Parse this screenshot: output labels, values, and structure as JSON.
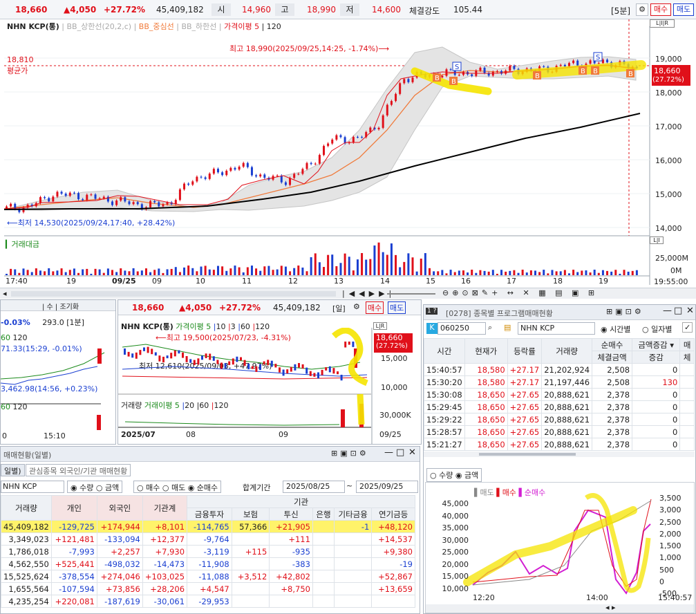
{
  "quote": {
    "price": "18,660",
    "change": "▲4,050",
    "change_pct": "+27.72%",
    "volume": "45,409,182",
    "open_label": "시",
    "open": "14,960",
    "high_label": "고",
    "high": "18,990",
    "low_label": "저",
    "low": "14,600",
    "strength_label": "체결강도",
    "strength": "105.44",
    "interval": "[5분]",
    "buy_label": "매수",
    "sell_label": "매도"
  },
  "main_chart": {
    "legend_name": "NHN KCP(통)",
    "legend_items": [
      "BB_상한선(20,2,c)",
      "BB_중심선",
      "BB_하한선",
      "가격이평 5",
      "120"
    ],
    "legend_colors": [
      "#bbbbbb",
      "#f07a3a",
      "#bbbbbb",
      "#e0101a",
      "#000000"
    ],
    "avg_label": "평균가",
    "avg_value": "18,810",
    "high_annot": "최고 18,990(2025/09/25,14:25, -1.74%)⟶",
    "low_annot": "⟵최저 14,530(2025/09/24,17:40, +28.42%)",
    "price_tag": "18,660",
    "price_tag_pct": "(27.72%)",
    "y_ticks": [
      "19,000",
      "18,000",
      "17,000",
      "16,000",
      "15,000",
      "14,000"
    ],
    "volume_label": "거래대금",
    "volume_ticks": [
      "25,000M",
      "0M"
    ],
    "x_ticks": [
      "17:40",
      "19",
      "09/25",
      "09",
      "10",
      "11",
      "12",
      "13",
      "14",
      "15",
      "16",
      "17",
      "18",
      "19",
      "19:55:00"
    ],
    "chart_data": {
      "type": "candlestick",
      "ylim": [
        14000,
        19200
      ],
      "close_approx": [
        14560,
        14620,
        14980,
        14950,
        14850,
        14760,
        14640,
        14720,
        15450,
        15600,
        15820,
        15480,
        15380,
        15850,
        16650,
        16580,
        17100,
        18400,
        18500,
        18560,
        18560,
        18600,
        18650,
        18650,
        18800,
        18850,
        18870,
        18660
      ],
      "ma120": [
        14560,
        14580,
        14600,
        14640,
        14700,
        14800,
        14950,
        15200,
        15500,
        15800,
        16100,
        16400,
        16750,
        17000,
        17200,
        17350
      ]
    }
  },
  "left_mini": {
    "pct": "-0.03%",
    "val": "293.0",
    "interval": "[1분]",
    "line1": "71.33(15:29, -0.01%)",
    "line2": "3,462.98(14:56, +0.23%)",
    "ma_items": [
      "60",
      "120"
    ],
    "x_ticks": [
      "0",
      "15:10"
    ]
  },
  "day_chart": {
    "price": "18,660",
    "change": "▲4,050",
    "change_pct": "+27.72%",
    "volume": "45,409,182",
    "interval": "[일]",
    "buy_label": "매수",
    "sell_label": "매도",
    "legend_name": "NHN KCP(통)",
    "legend_items": [
      "가격이평 5",
      "10",
      "3",
      "60",
      "120"
    ],
    "high_annot": "⟵최고 19,500(2025/07/23, -4.31%)",
    "low_annot": "최저 12,610(2025/09/03, +47.97%)",
    "price_tag": "18,660",
    "price_tag_pct": "(27.72%)",
    "y_ticks": [
      "15,000",
      "10,000"
    ],
    "vol_legend": [
      "거래량",
      "거래이평 5",
      "20",
      "60",
      "120"
    ],
    "vol_tick": "30,000K",
    "x_ticks": [
      "2025/07",
      "08",
      "09",
      "09/25"
    ]
  },
  "program": {
    "window_title": "[0278] 종목별 프로그램매매현황",
    "code": "060250",
    "name": "NHN KCP",
    "radio_time": "시간별",
    "radio_day": "일자별",
    "headers": [
      "시간",
      "현재가",
      "등락률",
      "거래량",
      "순매수",
      "금액증감",
      "매"
    ],
    "subheaders": [
      "체결금액",
      "증감",
      "체"
    ],
    "rows": [
      [
        "15:40:57",
        "18,580",
        "+27.17",
        "21,202,924",
        "2,508",
        "0"
      ],
      [
        "15:30:20",
        "18,580",
        "+27.17",
        "21,197,446",
        "2,508",
        "130"
      ],
      [
        "15:30:08",
        "18,650",
        "+27.65",
        "20,888,621",
        "2,378",
        "0"
      ],
      [
        "15:29:45",
        "18,650",
        "+27.65",
        "20,888,621",
        "2,378",
        "0"
      ],
      [
        "15:29:22",
        "18,650",
        "+27.65",
        "20,888,621",
        "2,378",
        "0"
      ],
      [
        "15:28:57",
        "18,650",
        "+27.65",
        "20,888,621",
        "2,378",
        "0"
      ],
      [
        "15:21:27",
        "18,650",
        "+27.65",
        "20,888,621",
        "2,378",
        "0"
      ]
    ],
    "radio_qty": "수량",
    "radio_amount": "금액",
    "legend": [
      "매도",
      "매수",
      "순매수"
    ],
    "y_left": [
      "45,000",
      "40,000",
      "35,000",
      "30,000",
      "25,000",
      "20,000",
      "15,000",
      "10,000"
    ],
    "y_right": [
      "3,500",
      "3,000",
      "2,500",
      "2,000",
      "1,500",
      "1,000",
      "500",
      "0",
      "-500"
    ],
    "x_ticks": [
      "12:20",
      "14:00",
      "15:40:57"
    ]
  },
  "investor": {
    "window_title": "매매현황(일별)",
    "tabs": [
      "일별)",
      "관심종목 외국인/기관 매매현황"
    ],
    "name": "NHN KCP",
    "radios": [
      "수량",
      "금액",
      "매수",
      "매도",
      "순매수"
    ],
    "period_label": "합계기간",
    "date_from": "2025/08/25",
    "date_to": "2025/09/25",
    "group_header": "기관",
    "headers": [
      "거래량",
      "개인",
      "외국인",
      "기관계",
      "금융투자",
      "보험",
      "투신",
      "은행",
      "기타금융",
      "연기금등"
    ],
    "rows": [
      [
        "45,409,182",
        "-129,725",
        "+174,944",
        "+8,101",
        "-114,765",
        "57,366",
        "+21,905",
        "",
        "-1",
        "+48,120"
      ],
      [
        "3,349,023",
        "+121,481",
        "-133,094",
        "+12,377",
        "-9,764",
        "",
        "+111",
        "",
        "",
        "+14,537"
      ],
      [
        "1,786,018",
        "-7,993",
        "+2,257",
        "+7,930",
        "-3,119",
        "+115",
        "-935",
        "",
        "",
        "+9,380"
      ],
      [
        "4,562,550",
        "+525,441",
        "-498,032",
        "-14,473",
        "-11,908",
        "",
        "-383",
        "",
        "",
        "-19"
      ],
      [
        "15,525,624",
        "-378,554",
        "+274,046",
        "+103,025",
        "-11,088",
        "+3,512",
        "+42,802",
        "",
        "",
        "+52,867"
      ],
      [
        "1,655,564",
        "-107,594",
        "+73,856",
        "+28,206",
        "+4,547",
        "",
        "+8,750",
        "",
        "",
        "+13,659"
      ],
      [
        "4,235,254",
        "+220,081",
        "-187,619",
        "-30,061",
        "-29,953",
        "",
        "",
        "",
        "",
        ""
      ]
    ]
  }
}
